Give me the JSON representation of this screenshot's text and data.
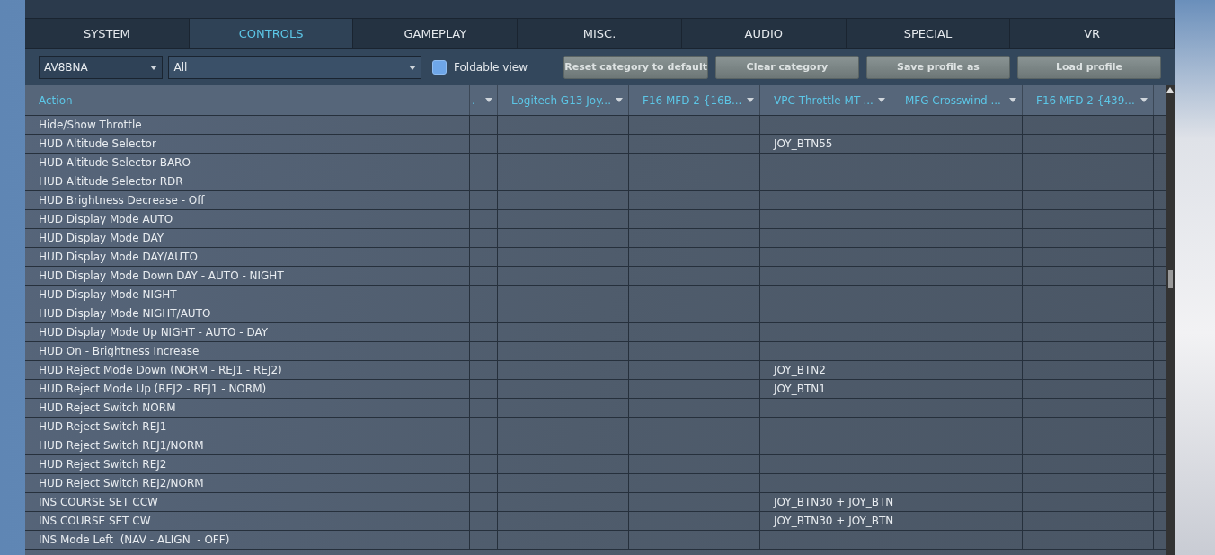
{
  "tabs": [
    {
      "label": "SYSTEM",
      "selected": false
    },
    {
      "label": "CONTROLS",
      "selected": true
    },
    {
      "label": "GAMEPLAY",
      "selected": false
    },
    {
      "label": "MISC.",
      "selected": false
    },
    {
      "label": "AUDIO",
      "selected": false
    },
    {
      "label": "SPECIAL",
      "selected": false
    },
    {
      "label": "VR",
      "selected": false
    }
  ],
  "toolbar": {
    "aircraft": "AV8BNA",
    "category": "All",
    "foldable_view": {
      "label": "Foldable view",
      "checked": false
    },
    "buttons": [
      "Reset category to default",
      "Clear category",
      "Save profile as",
      "Load profile"
    ]
  },
  "table": {
    "action_header": "Action",
    "columns": [
      ".",
      "Logitech G13 Joy...",
      "F16 MFD 2 {16B...",
      "VPC Throttle MT-...",
      "MFG Crosswind ...",
      "F16 MFD 2 {439..."
    ],
    "rows": [
      {
        "action": "Hide/Show Throttle"
      },
      {
        "action": "HUD Altitude Selector",
        "cells": [
          null,
          null,
          null,
          "JOY_BTN55",
          null,
          null
        ]
      },
      {
        "action": "HUD Altitude Selector BARO"
      },
      {
        "action": "HUD Altitude Selector RDR"
      },
      {
        "action": "HUD Brightness Decrease - Off"
      },
      {
        "action": "HUD Display Mode AUTO"
      },
      {
        "action": "HUD Display Mode DAY"
      },
      {
        "action": "HUD Display Mode DAY/AUTO"
      },
      {
        "action": "HUD Display Mode Down DAY - AUTO - NIGHT"
      },
      {
        "action": "HUD Display Mode NIGHT"
      },
      {
        "action": "HUD Display Mode NIGHT/AUTO"
      },
      {
        "action": "HUD Display Mode Up NIGHT - AUTO - DAY"
      },
      {
        "action": "HUD On - Brightness Increase"
      },
      {
        "action": "HUD Reject Mode Down (NORM - REJ1 - REJ2)",
        "cells": [
          null,
          null,
          null,
          "JOY_BTN2",
          null,
          null
        ]
      },
      {
        "action": "HUD Reject Mode Up (REJ2 - REJ1 - NORM)",
        "cells": [
          null,
          null,
          null,
          "JOY_BTN1",
          null,
          null
        ]
      },
      {
        "action": "HUD Reject Switch NORM"
      },
      {
        "action": "HUD Reject Switch REJ1"
      },
      {
        "action": "HUD Reject Switch REJ1/NORM"
      },
      {
        "action": "HUD Reject Switch REJ2"
      },
      {
        "action": "HUD Reject Switch REJ2/NORM"
      },
      {
        "action": "INS COURSE SET CCW",
        "cells": [
          null,
          null,
          null,
          "JOY_BTN30 + JOY_BTN",
          null,
          null
        ]
      },
      {
        "action": "INS COURSE SET CW",
        "cells": [
          null,
          null,
          null,
          "JOY_BTN30 + JOY_BTN",
          null,
          null
        ]
      },
      {
        "action": "INS Mode Left  (NAV - ALIGN  - OFF)"
      }
    ]
  }
}
